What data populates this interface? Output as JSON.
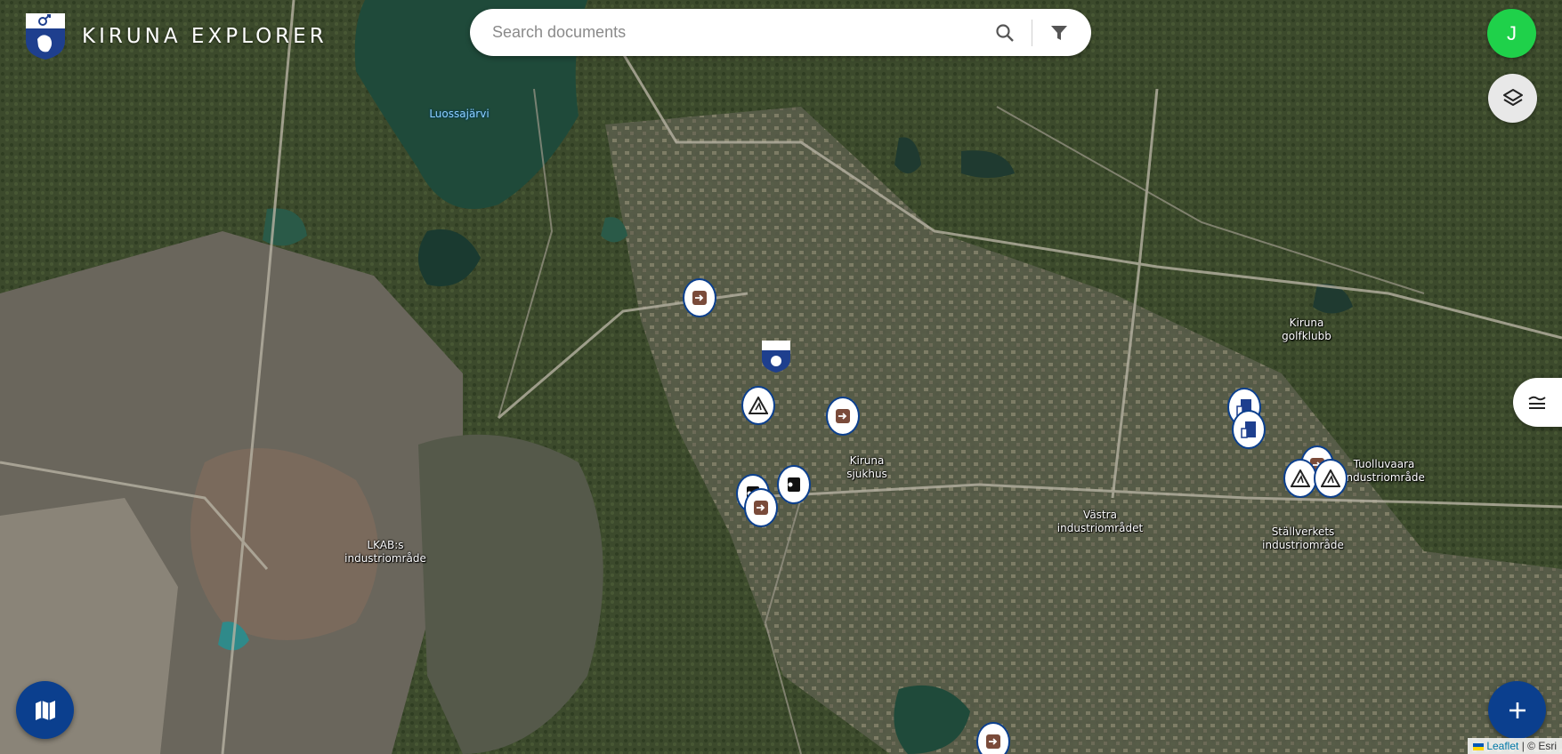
{
  "app": {
    "title": "KIRUNA EXPLORER"
  },
  "search": {
    "placeholder": "Search documents"
  },
  "user": {
    "initial": "J"
  },
  "colors": {
    "accent": "#0b3f8e",
    "avatar": "#1fd14a",
    "marker_border": "#0b3f8e"
  },
  "icons": {
    "logo": "kiruna-coat-of-arms-icon",
    "search": "search-icon",
    "filter": "filter-icon",
    "layers": "layers-icon",
    "legend": "lines-icon",
    "map": "map-icon",
    "add": "plus-icon"
  },
  "map": {
    "labels": [
      {
        "text": "Luossajärvi",
        "kind": "water"
      },
      {
        "text": "LKAB:s\nindustriområde",
        "kind": "place"
      },
      {
        "text": "Kiruna\nsjukhus",
        "kind": "place"
      },
      {
        "text": "Västra\nindustriområdet",
        "kind": "place"
      },
      {
        "text": "Ställverkets\nindustriområde",
        "kind": "place"
      },
      {
        "text": "Tuolluvaara\nindustriområde",
        "kind": "place"
      },
      {
        "text": "Kiruna\ngolfklubb",
        "kind": "place"
      }
    ],
    "markers": [
      {
        "type": "door"
      },
      {
        "type": "coat-of-arms"
      },
      {
        "type": "construction"
      },
      {
        "type": "door"
      },
      {
        "type": "document-dark"
      },
      {
        "type": "document-dark"
      },
      {
        "type": "door"
      },
      {
        "type": "door"
      },
      {
        "type": "building"
      },
      {
        "type": "building"
      },
      {
        "type": "door"
      },
      {
        "type": "construction"
      },
      {
        "type": "construction"
      }
    ]
  },
  "attribution": {
    "leaflet": "Leaflet",
    "separator": " | © ",
    "esri": "Esri"
  }
}
